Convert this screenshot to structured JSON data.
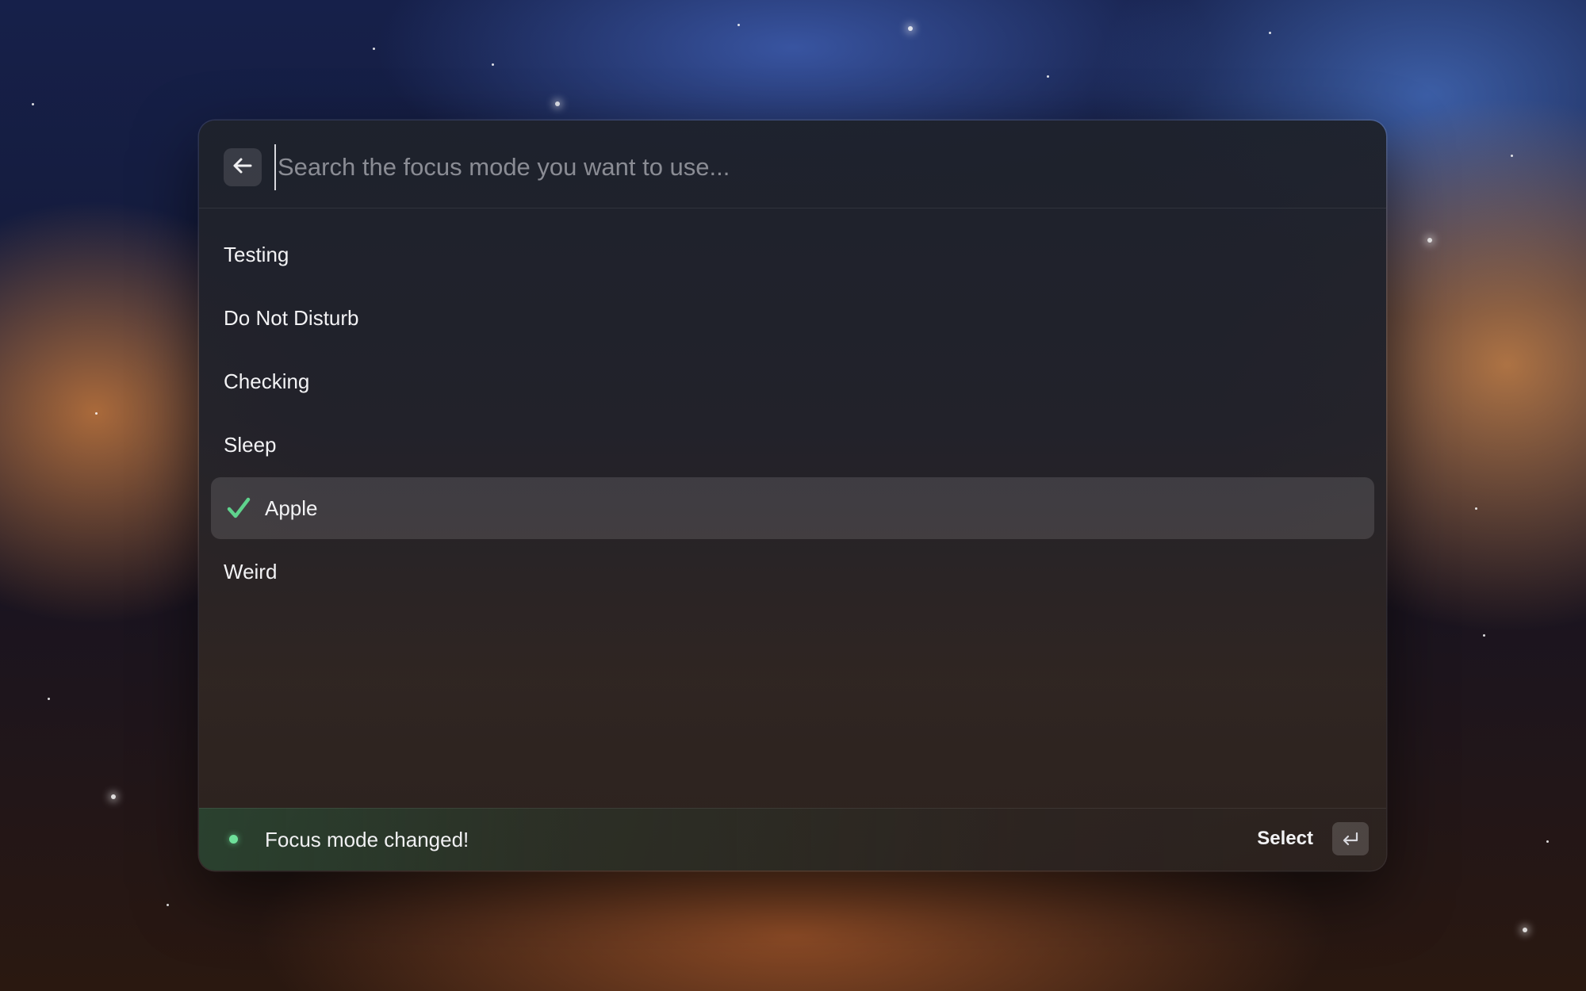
{
  "search": {
    "placeholder": "Search the focus mode you want to use...",
    "value": ""
  },
  "focus_modes": [
    {
      "label": "Testing",
      "selected": false
    },
    {
      "label": "Do Not Disturb",
      "selected": false
    },
    {
      "label": "Checking",
      "selected": false
    },
    {
      "label": "Sleep",
      "selected": false
    },
    {
      "label": "Apple",
      "selected": true
    },
    {
      "label": "Weird",
      "selected": false
    }
  ],
  "footer": {
    "status_text": "Focus mode changed!",
    "action_label": "Select"
  },
  "icons": {
    "back": "arrow-left-icon",
    "check": "checkmark-icon",
    "enter": "return-key-icon",
    "status": "status-dot"
  },
  "colors": {
    "accent_green": "#6ee09a",
    "check_green": "#5fd38d"
  }
}
